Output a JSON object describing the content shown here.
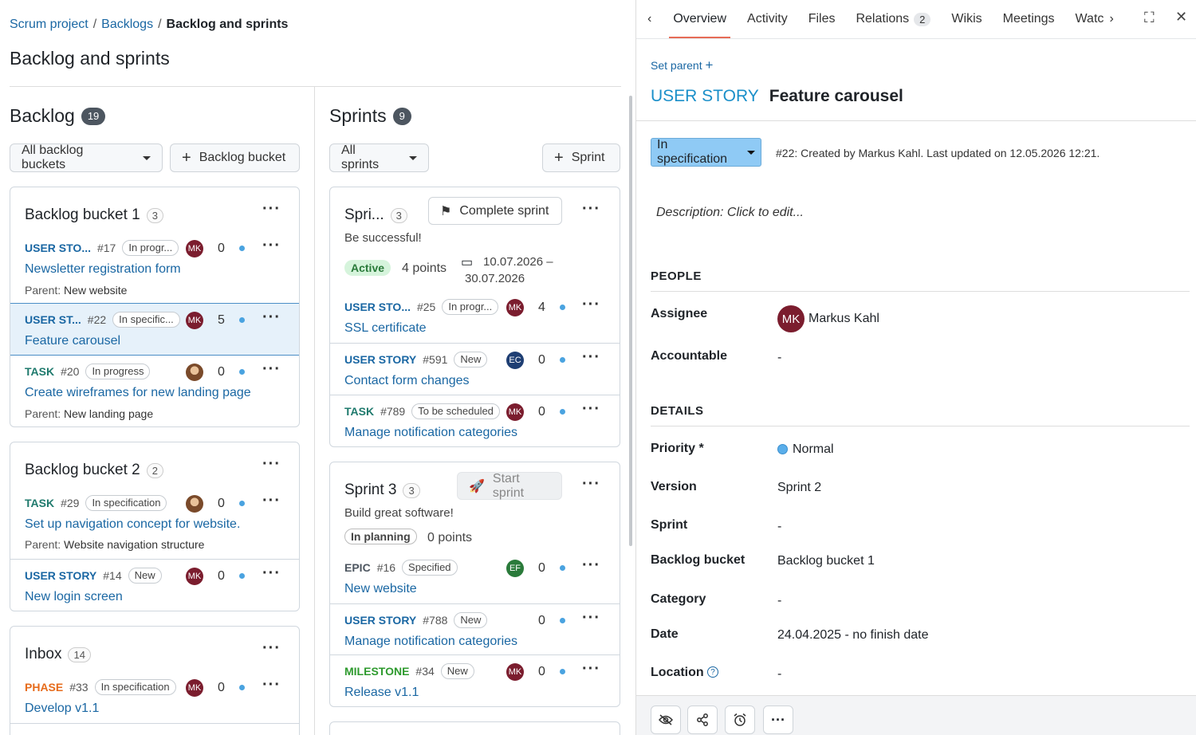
{
  "breadcrumb": {
    "items": [
      "Scrum project",
      "Backlogs"
    ],
    "current": "Backlog and sprints"
  },
  "page_title": "Backlog and sprints",
  "backlog": {
    "title": "Backlog",
    "count": "19",
    "filter": "All backlog buckets",
    "add_label": "Backlog bucket",
    "buckets": [
      {
        "title": "Backlog bucket 1",
        "count": "3",
        "items": [
          {
            "type": "USER STO...",
            "num": "#17",
            "status": "In progr...",
            "avatar": "MK",
            "points": "0",
            "subject": "Newsletter registration form",
            "parent_label": "Parent:",
            "parent": "New website"
          },
          {
            "type": "USER ST...",
            "num": "#22",
            "status": "In specific...",
            "avatar": "MK",
            "points": "5",
            "subject": "Feature carousel"
          },
          {
            "type": "TASK",
            "num": "#20",
            "status": "In progress",
            "avatar": "",
            "points": "0",
            "subject": "Create wireframes for new landing page",
            "parent_label": "Parent:",
            "parent": "New landing page"
          }
        ]
      },
      {
        "title": "Backlog bucket 2",
        "count": "2",
        "items": [
          {
            "type": "TASK",
            "num": "#29",
            "status": "In specification",
            "avatar": "",
            "points": "0",
            "subject": "Set up navigation concept for website.",
            "parent_label": "Parent:",
            "parent": "Website navigation structure"
          },
          {
            "type": "USER STORY",
            "num": "#14",
            "status": "New",
            "avatar": "MK",
            "points": "0",
            "subject": "New login screen"
          }
        ]
      },
      {
        "title": "Inbox",
        "count": "14",
        "items": [
          {
            "type": "PHASE",
            "num": "#33",
            "status": "In specification",
            "avatar": "MK",
            "points": "0",
            "subject": "Develop v1.1"
          }
        ]
      }
    ]
  },
  "sprints": {
    "title": "Sprints",
    "count": "9",
    "filter": "All sprints",
    "add_label": "Sprint",
    "list": [
      {
        "title": "Spri...",
        "count": "3",
        "action": "Complete sprint",
        "desc": "Be successful!",
        "state": "Active",
        "points": "4 points",
        "dates": "10.07.2026 – 30.07.2026",
        "items": [
          {
            "type": "USER STO...",
            "num": "#25",
            "status": "In progr...",
            "avatar": "MK",
            "points": "4",
            "subject": "SSL certificate"
          },
          {
            "type": "USER STORY",
            "num": "#591",
            "status": "New",
            "avatar": "EC",
            "points": "0",
            "subject": "Contact form changes"
          },
          {
            "type": "TASK",
            "num": "#789",
            "status": "To be scheduled",
            "avatar": "MK",
            "points": "0",
            "subject": "Manage notification categories"
          }
        ]
      },
      {
        "title": "Sprint 3",
        "count": "3",
        "action": "Start sprint",
        "desc": "Build great software!",
        "state": "In planning",
        "points": "0 points",
        "items": [
          {
            "type": "EPIC",
            "num": "#16",
            "status": "Specified",
            "avatar": "EF",
            "points": "0",
            "subject": "New website"
          },
          {
            "type": "USER STORY",
            "num": "#788",
            "status": "New",
            "avatar": "",
            "points": "0",
            "subject": "Manage notification categories"
          },
          {
            "type": "MILESTONE",
            "num": "#34",
            "status": "New",
            "avatar": "MK",
            "points": "0",
            "subject": "Release v1.1"
          }
        ]
      }
    ]
  },
  "detail": {
    "tabs": [
      {
        "label": "Overview"
      },
      {
        "label": "Activity"
      },
      {
        "label": "Files"
      },
      {
        "label": "Relations",
        "count": "2"
      },
      {
        "label": "Wikis"
      },
      {
        "label": "Meetings"
      },
      {
        "label": "Watc"
      }
    ],
    "set_parent": "Set parent",
    "type": "USER STORY",
    "subject": "Feature carousel",
    "status": "In specification",
    "created_info": "#22: Created by Markus Kahl. Last updated on 12.05.2026 12:21.",
    "description_placeholder": "Description: Click to edit...",
    "people_title": "PEOPLE",
    "assignee_label": "Assignee",
    "assignee_initials": "MK",
    "assignee": "Markus Kahl",
    "accountable_label": "Accountable",
    "accountable": "-",
    "details_title": "DETAILS",
    "priority_label": "Priority *",
    "priority": "Normal",
    "version_label": "Version",
    "version": "Sprint 2",
    "sprint_label": "Sprint",
    "sprint": "-",
    "bucket_label": "Backlog bucket",
    "bucket": "Backlog bucket 1",
    "category_label": "Category",
    "category": "-",
    "date_label": "Date",
    "date": "24.04.2025 - no finish date",
    "location_label": "Location",
    "location": "-"
  },
  "colors": {
    "accent": "#1a67a3",
    "status_selected": "#8fcaf5",
    "priority": "#5aaeea",
    "avatar_mk": "#7b1d2e"
  }
}
